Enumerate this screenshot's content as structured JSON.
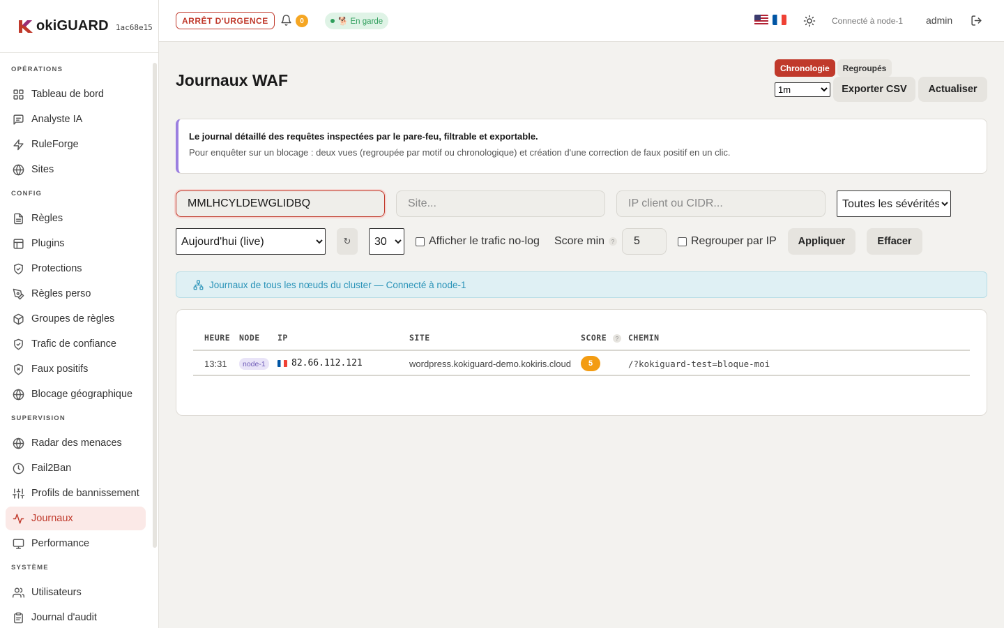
{
  "brand": {
    "name": "okiGUARD",
    "hash": "1ac68e15"
  },
  "sidebar": {
    "sections": [
      {
        "title": "OPÉRATIONS",
        "items": [
          {
            "label": "Tableau de bord",
            "icon": "grid-icon"
          },
          {
            "label": "Analyste IA",
            "icon": "chat-icon"
          },
          {
            "label": "RuleForge",
            "icon": "bolt-icon"
          },
          {
            "label": "Sites",
            "icon": "globe-icon"
          }
        ]
      },
      {
        "title": "CONFIG",
        "items": [
          {
            "label": "Règles",
            "icon": "file-icon"
          },
          {
            "label": "Plugins",
            "icon": "layout-icon"
          },
          {
            "label": "Protections",
            "icon": "shield-check-icon"
          },
          {
            "label": "Règles perso",
            "icon": "pen-tool-icon"
          },
          {
            "label": "Groupes de règles",
            "icon": "box-icon"
          },
          {
            "label": "Trafic de confiance",
            "icon": "shield-check-icon"
          },
          {
            "label": "Faux positifs",
            "icon": "shield-x-icon"
          },
          {
            "label": "Blocage géographique",
            "icon": "globe-icon"
          }
        ]
      },
      {
        "title": "SUPERVISION",
        "items": [
          {
            "label": "Radar des menaces",
            "icon": "globe-icon"
          },
          {
            "label": "Fail2Ban",
            "icon": "clock-icon"
          },
          {
            "label": "Profils de bannissement",
            "icon": "sliders-icon"
          },
          {
            "label": "Journaux",
            "icon": "activity-icon",
            "active": true
          },
          {
            "label": "Performance",
            "icon": "monitor-icon"
          }
        ]
      },
      {
        "title": "SYSTÈME",
        "items": [
          {
            "label": "Utilisateurs",
            "icon": "users-icon"
          },
          {
            "label": "Journal d'audit",
            "icon": "clipboard-icon"
          }
        ]
      }
    ]
  },
  "topbar": {
    "emergency_label": "ARRÊT D'URGENCE",
    "notification_count": "0",
    "status_label": "🐕 En garde",
    "connected_label": "Connecté à node-1",
    "user": "admin"
  },
  "page": {
    "title": "Journaux WAF",
    "view_modes": [
      "Chronologie",
      "Regroupés"
    ],
    "refresh_interval": "1m",
    "export_label": "Exporter CSV",
    "refresh_label": "Actualiser",
    "info_title": "Le journal détaillé des requêtes inspectées par le pare-feu, filtrable et exportable.",
    "info_text": "Pour enquêter sur un blocage : deux vues (regroupée par motif ou chronologique) et création d'une correction de faux positif en un clic."
  },
  "filters": {
    "search_value": "MMLHCYLDEWGLIDBQ",
    "site_placeholder": "Site...",
    "ip_placeholder": "IP client ou CIDR...",
    "severity_value": "Toutes les sévérités",
    "period_value": "Aujourd'hui (live)",
    "refresh_symbol": "↻",
    "limit_value": "30",
    "nolog_label": "Afficher le trafic no-log",
    "score_min_label": "Score min",
    "score_min_value": "5",
    "group_ip_label": "Regrouper par IP",
    "apply_label": "Appliquer",
    "clear_label": "Effacer"
  },
  "cluster_notice": "Journaux de tous les nœuds du cluster — Connecté à node-1",
  "table": {
    "headers": {
      "time": "HEURE",
      "node": "NODE",
      "ip": "IP",
      "site": "SITE",
      "score": "SCORE",
      "path": "CHEMIN"
    },
    "rows": [
      {
        "time": "13:31",
        "node": "node-1",
        "ip": "82.66.112.121",
        "site": "wordpress.kokiguard-demo.kokiris.cloud",
        "score": "5",
        "path": "/?kokiguard-test=bloque-moi"
      }
    ]
  }
}
